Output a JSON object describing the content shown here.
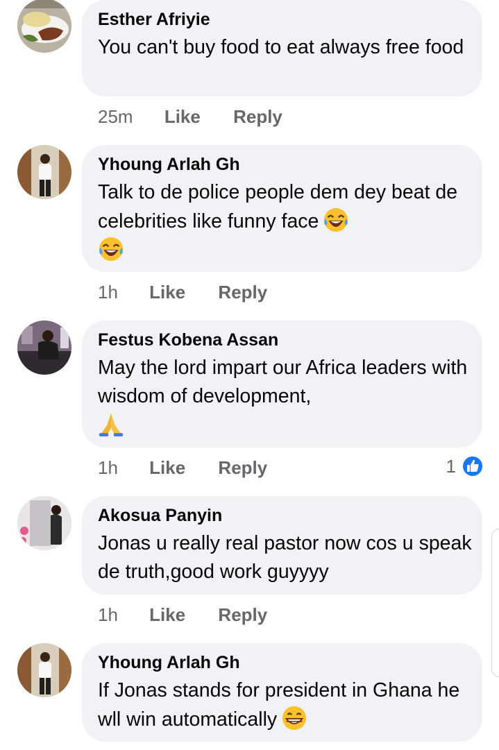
{
  "comments": [
    {
      "author": "Esther Afriyie",
      "text": "You can't buy food to eat always free food",
      "time": "25m",
      "like_label": "Like",
      "reply_label": "Reply",
      "avatar": "food-plate-avatar"
    },
    {
      "author": "Yhoung Arlah Gh",
      "text": "Talk to de police people dem dey beat de celebrities like funny face",
      "emoji": "tears-of-joy-emoji",
      "time": "1h",
      "like_label": "Like",
      "reply_label": "Reply",
      "avatar": "person-standing-avatar"
    },
    {
      "author": "Festus Kobena Assan",
      "text": "May the lord impart our Africa leaders with wisdom of development,",
      "emoji": "folded-hands-emoji",
      "time": "1h",
      "like_label": "Like",
      "reply_label": "Reply",
      "like_count": "1",
      "avatar": "person-sitting-avatar"
    },
    {
      "author": "Akosua Panyin",
      "text": "Jonas u really real pastor now cos u speak de truth,good work guyyyy",
      "time": "1h",
      "like_label": "Like",
      "reply_label": "Reply",
      "avatar": "person-mirror-avatar"
    },
    {
      "author": "Yhoung Arlah Gh",
      "text": "If Jonas stands for president in Ghana he wll win automatically",
      "emoji": "grinning-emoji",
      "avatar": "person-standing-avatar"
    }
  ],
  "colors": {
    "bubble": "#f0f2f5",
    "meta_text": "#65676b",
    "like_blue": "#1877f2"
  }
}
